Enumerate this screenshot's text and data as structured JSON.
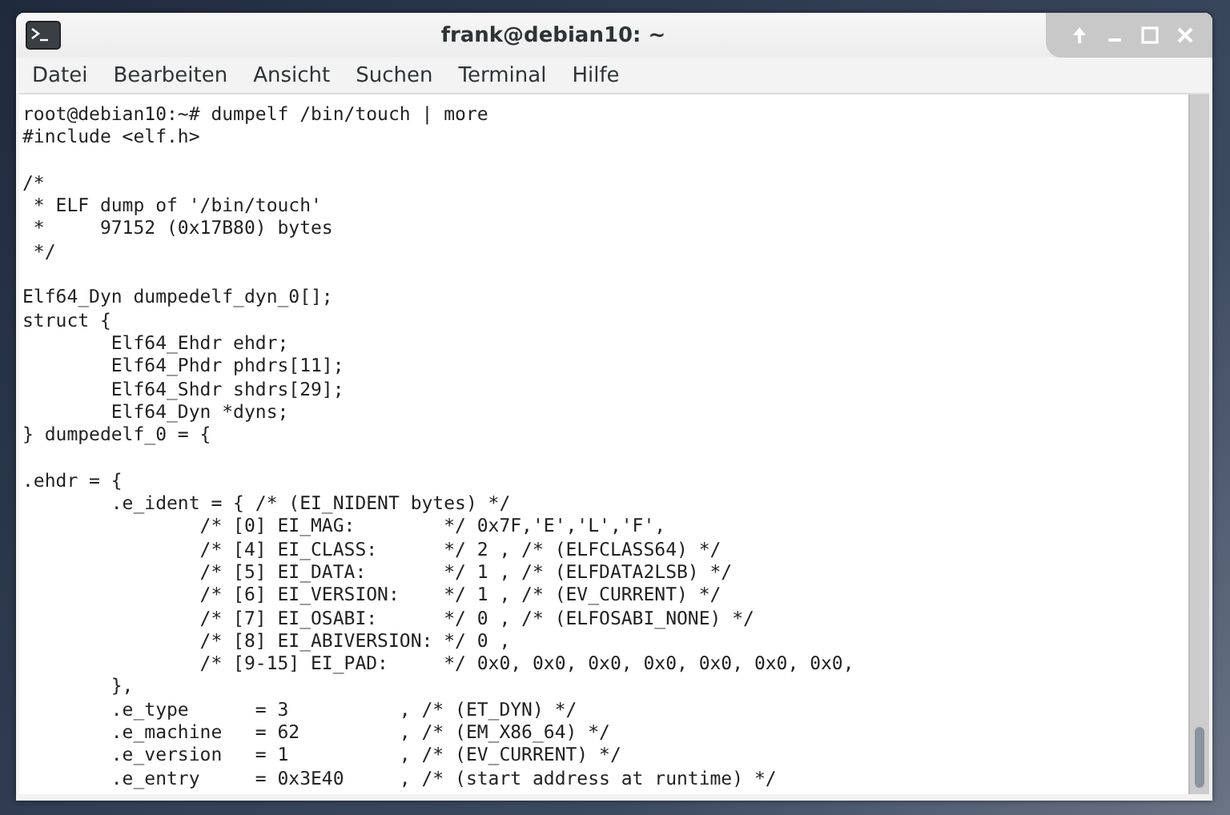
{
  "window": {
    "title": "frank@debian10: ~"
  },
  "menu": [
    "Datei",
    "Bearbeiten",
    "Ansicht",
    "Suchen",
    "Terminal",
    "Hilfe"
  ],
  "terminal": {
    "blocks": [
      [
        "root@debian10:~# dumpelf /bin/touch | more",
        "#include <elf.h>"
      ],
      [
        "/*",
        " * ELF dump of '/bin/touch'",
        " *     97152 (0x17B80) bytes",
        " */"
      ],
      [
        "Elf64_Dyn dumpedelf_dyn_0[];",
        "struct {",
        "        Elf64_Ehdr ehdr;",
        "        Elf64_Phdr phdrs[11];",
        "        Elf64_Shdr shdrs[29];",
        "        Elf64_Dyn *dyns;",
        "} dumpedelf_0 = {"
      ],
      [
        ".ehdr = {",
        "        .e_ident = { /* (EI_NIDENT bytes) */",
        "                /* [0] EI_MAG:        */ 0x7F,'E','L','F',",
        "                /* [4] EI_CLASS:      */ 2 , /* (ELFCLASS64) */",
        "                /* [5] EI_DATA:       */ 1 , /* (ELFDATA2LSB) */",
        "                /* [6] EI_VERSION:    */ 1 , /* (EV_CURRENT) */",
        "                /* [7] EI_OSABI:      */ 0 , /* (ELFOSABI_NONE) */",
        "                /* [8] EI_ABIVERSION: */ 0 ,",
        "                /* [9-15] EI_PAD:     */ 0x0, 0x0, 0x0, 0x0, 0x0, 0x0, 0x0,",
        "        },",
        "        .e_type      = 3          , /* (ET_DYN) */",
        "        .e_machine   = 62         , /* (EM_X86_64) */",
        "        .e_version   = 1          , /* (EV_CURRENT) */",
        "        .e_entry     = 0x3E40     , /* (start address at runtime) */"
      ]
    ]
  }
}
